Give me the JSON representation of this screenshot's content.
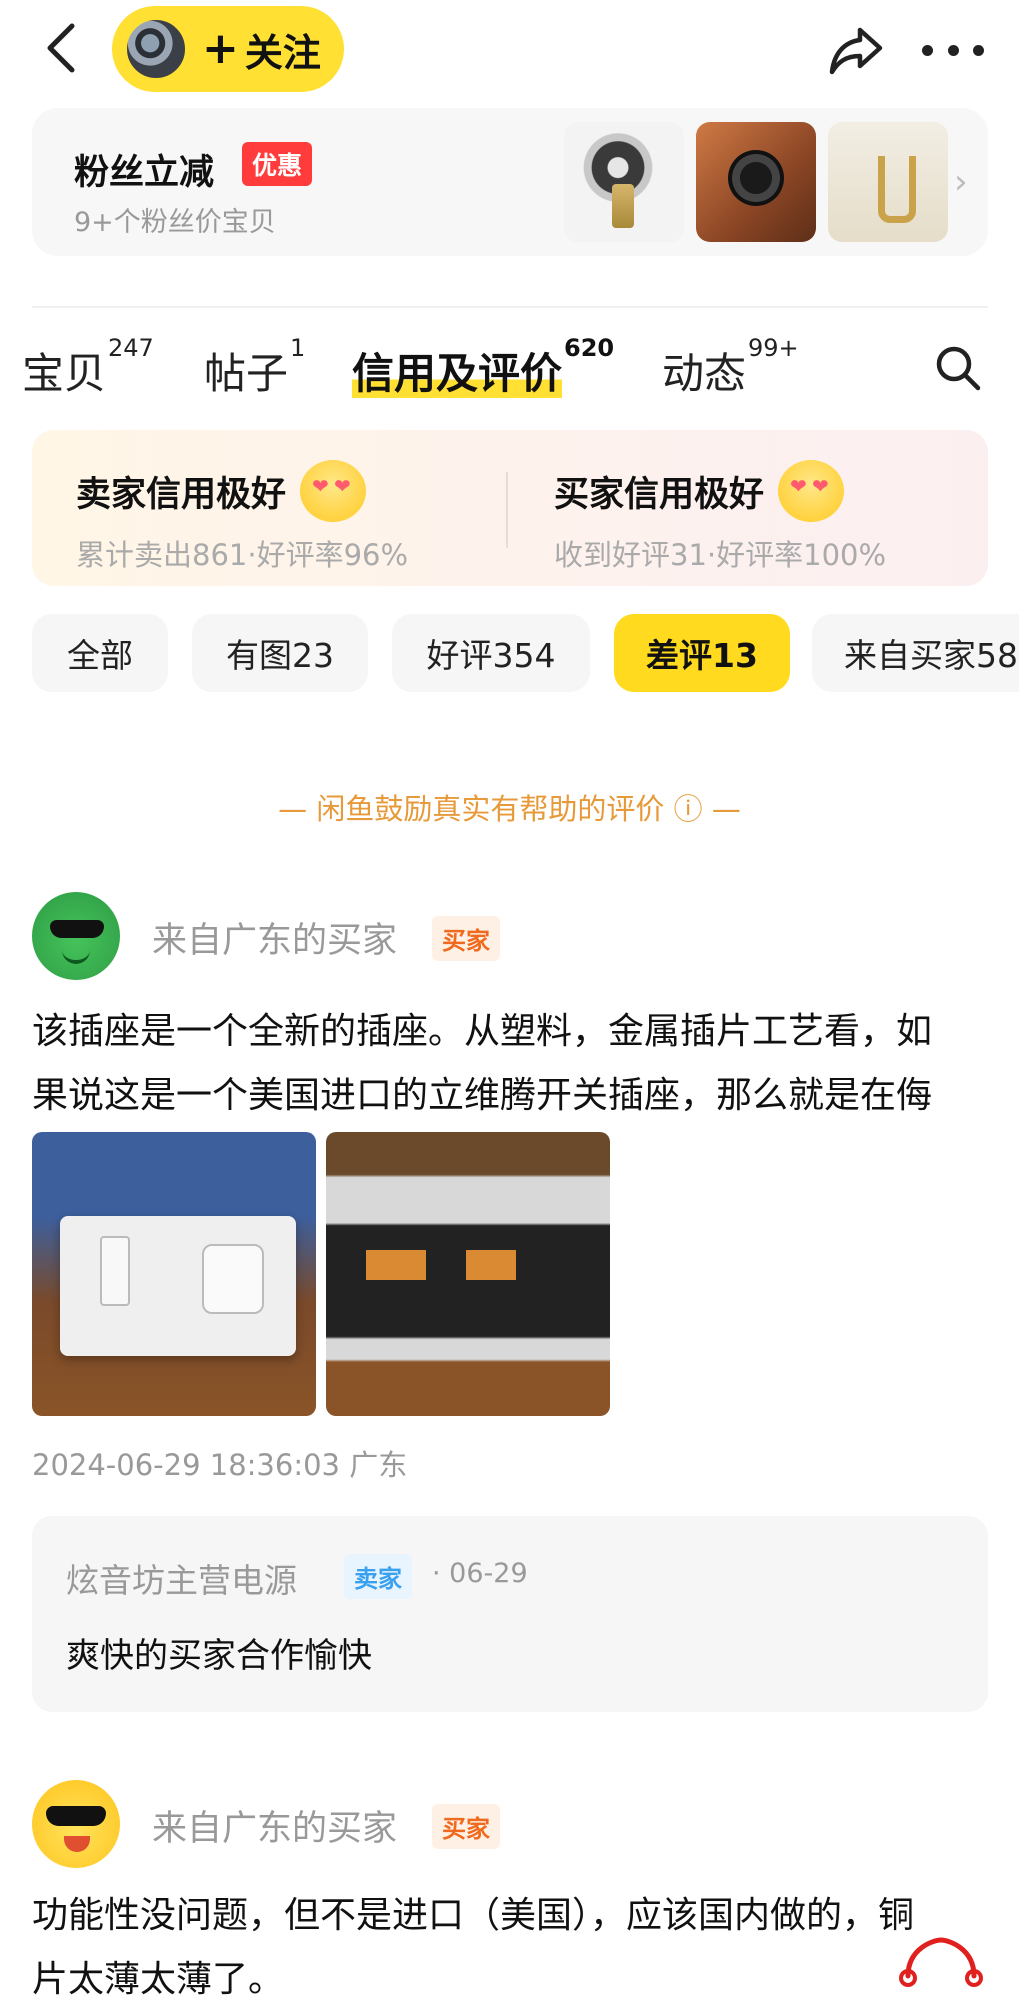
{
  "header": {
    "follow_plus": "+",
    "follow_label": "关注"
  },
  "fan_card": {
    "title": "粉丝立减",
    "badge": "优惠",
    "subtitle": "9+个粉丝价宝贝",
    "thumbnails": [
      "power-connector",
      "copper-socket",
      "spade-terminal"
    ]
  },
  "tabs": [
    {
      "label": "宝贝",
      "count": "247"
    },
    {
      "label": "帖子",
      "count": "1"
    },
    {
      "label": "信用及评价",
      "count": "620"
    },
    {
      "label": "动态",
      "count": "99+"
    }
  ],
  "credit": {
    "seller": {
      "title": "卖家信用极好",
      "sub": "累计卖出861·好评率96%"
    },
    "buyer": {
      "title": "买家信用极好",
      "sub": "收到好评31·好评率100%"
    }
  },
  "filters": [
    "全部",
    "有图23",
    "好评354",
    "差评13",
    "来自买家58"
  ],
  "active_filter": "差评13",
  "encourage": "— 闲鱼鼓励真实有帮助的评价 ⓘ —",
  "reviews": [
    {
      "reviewer": "来自广东的买家",
      "role": "买家",
      "text_line1": "该插座是一个全新的插座。从塑料，金属插片工艺看，如",
      "text_line2": "果说这是一个美国进口的立维腾开关插座，那么就是在侮",
      "timestamp": "2024-06-29 18:36:03 广东",
      "reply": {
        "name": "炫音坊主营电源",
        "role": "卖家",
        "date": "· 06-29",
        "text": "爽快的买家合作愉快"
      }
    },
    {
      "reviewer": "来自广东的买家",
      "role": "买家",
      "text_line1": "功能性没问题，但不是进口（美国），应该国内做的，铜",
      "text_line2": "片太薄太薄了。"
    }
  ],
  "colors": {
    "brand_yellow": "#FFE033",
    "chip_active": "#FFDA1F",
    "buyer_badge": "#F06A1D",
    "seller_badge": "#3AA0F0",
    "discount_red": "#FF3B3B",
    "encourage_orange": "#E79A3A"
  }
}
